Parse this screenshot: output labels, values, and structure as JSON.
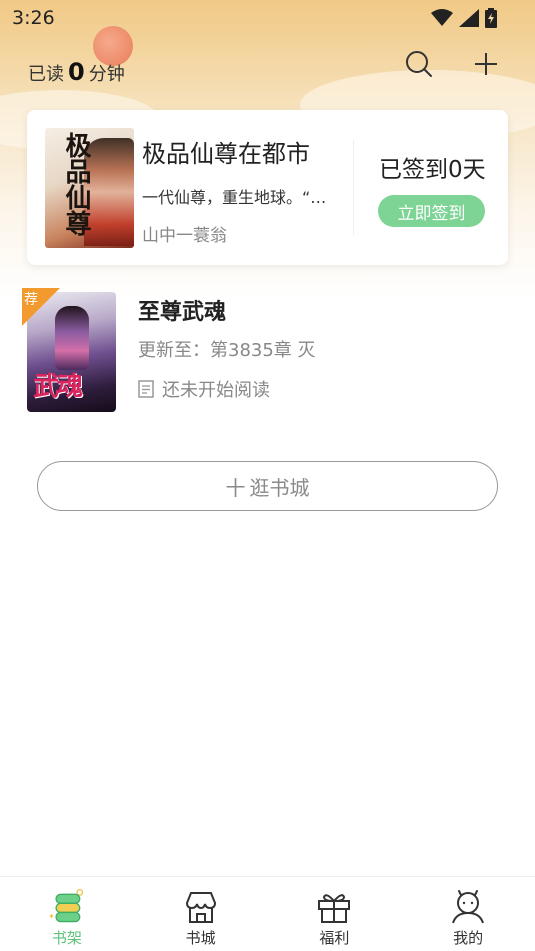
{
  "status_bar": {
    "time": "3:26"
  },
  "header": {
    "read_prefix": "已读",
    "read_minutes": "0",
    "read_suffix": "分钟",
    "search_icon": "search-icon",
    "add_icon": "plus-icon"
  },
  "sign_card": {
    "book_title": "极品仙尊在都市",
    "intro": "一代仙尊，重生地球。“…",
    "author": "山中一蓑翁",
    "cover_text": "极品仙尊",
    "sign_status": "已签到0天",
    "sign_button": "立即签到"
  },
  "bookshelf": [
    {
      "badge": "荐",
      "title": "至尊武魂",
      "update": "更新至：第3835章 灭",
      "progress": "还未开始阅读",
      "cover_text": "武魂"
    }
  ],
  "browse_button": {
    "prefix": "十",
    "label": "逛书城"
  },
  "bottom_nav": [
    {
      "label": "书架",
      "icon": "bookshelf-icon",
      "active": true
    },
    {
      "label": "书城",
      "icon": "store-icon",
      "active": false
    },
    {
      "label": "福利",
      "icon": "gift-icon",
      "active": false
    },
    {
      "label": "我的",
      "icon": "profile-icon",
      "active": false
    }
  ],
  "colors": {
    "accent_green": "#7dd494",
    "active_nav": "#5ec27a",
    "badge_orange": "#f39a2e",
    "header_gold": "#f0c985"
  }
}
